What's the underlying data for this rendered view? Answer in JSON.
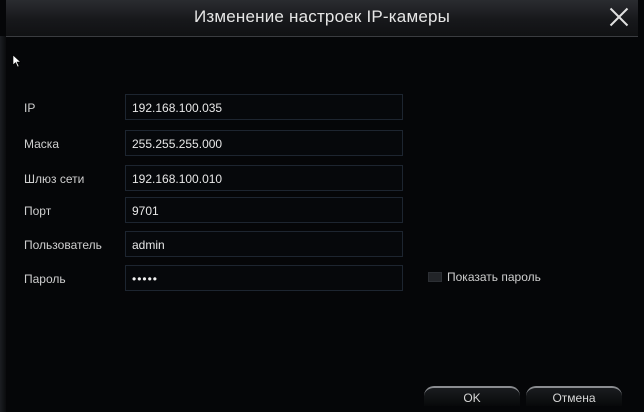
{
  "dialog": {
    "title": "Изменение настроек IP-камеры"
  },
  "fields": {
    "ip": {
      "label": "IP",
      "value": "192.168.100.035"
    },
    "mask": {
      "label": "Маска",
      "value": "255.255.255.000"
    },
    "gateway": {
      "label": "Шлюз сети",
      "value": "192.168.100.010"
    },
    "port": {
      "label": "Порт",
      "value": "9701"
    },
    "user": {
      "label": "Пользователь",
      "value": "admin"
    },
    "password": {
      "label": "Пароль",
      "value": "•••••"
    }
  },
  "show_password": {
    "label": "Показать пароль",
    "checked": false
  },
  "buttons": {
    "ok": "OK",
    "cancel": "Отмена"
  },
  "colors": {
    "background": "#050608",
    "text": "#d8d8d8",
    "input_border": "#1d2530"
  },
  "icons": {
    "close": "close-icon",
    "cursor": "mouse-pointer-icon"
  }
}
